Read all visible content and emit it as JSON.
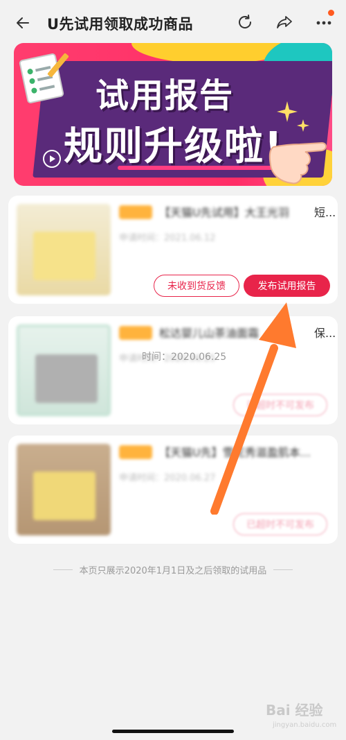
{
  "header": {
    "title": "U先试用领取成功商品",
    "icons": [
      "back-arrow-icon",
      "refresh-icon",
      "share-icon",
      "more-icon"
    ],
    "badge_color": "#ff5a1f"
  },
  "banner": {
    "line1": "试用报告",
    "line2": "规则升级啦!"
  },
  "cards": [
    {
      "title": "【天猫U先试用】大王光羽",
      "title_tail": "短...",
      "date": "申请时间：2021.06.12",
      "buttons": [
        "未收到货反馈",
        "发布试用报告"
      ]
    },
    {
      "title": "松达婴儿山茶油面霜",
      "title_tail": "保...",
      "date": "申请时间：2020.06.25",
      "date_visible": "时间：2020.06.25",
      "button": "已超时不可发布"
    },
    {
      "title": "【天猫U先】雪花秀滋盈肌本...",
      "date": "申请时间：2020.06.27",
      "button": "已超时不可发布"
    }
  ],
  "footer": {
    "note": "本页只展示2020年1月1日及之后领取的试用品"
  },
  "watermark": {
    "text": "Bai 经验",
    "sub": "jingyan.baidu.com"
  },
  "colors": {
    "accent": "#e8244a",
    "tag": "#ffb33d",
    "annotation_arrow": "#ff7a2e"
  }
}
